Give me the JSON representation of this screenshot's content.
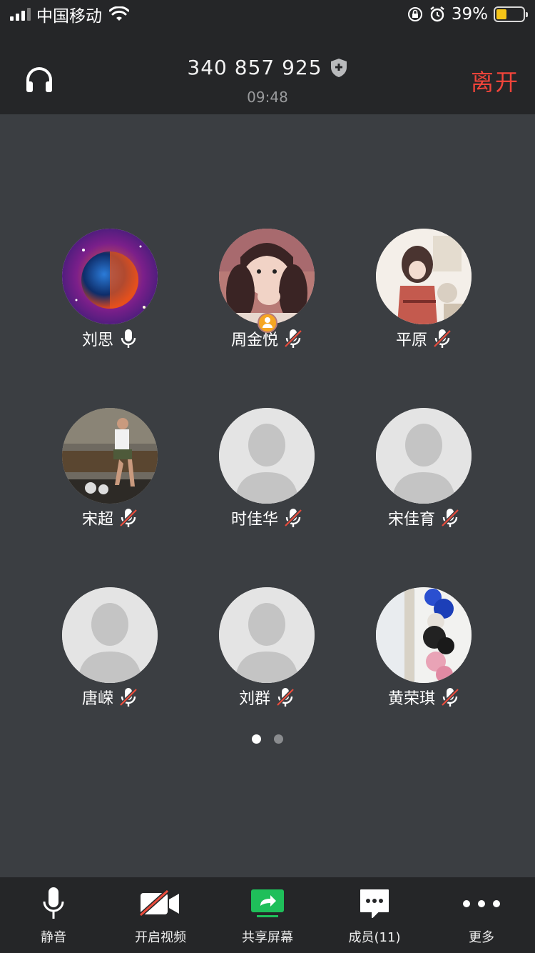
{
  "status_bar": {
    "carrier": "中国移动",
    "battery": "39%",
    "battery_level": 0.39,
    "battery_color": "#f5c518"
  },
  "header": {
    "meeting_id": "340 857 925",
    "timer": "09:48",
    "leave_label": "离开",
    "leave_color": "#f2443a"
  },
  "participants": [
    {
      "name": "刘思",
      "mic": "on",
      "avatar": "planet-photo"
    },
    {
      "name": "周金悦",
      "mic": "muted",
      "avatar": "girl-photo",
      "host": true
    },
    {
      "name": "平原",
      "mic": "muted",
      "avatar": "illustration"
    },
    {
      "name": "宋超",
      "mic": "muted",
      "avatar": "man-photo"
    },
    {
      "name": "时佳华",
      "mic": "muted",
      "avatar": "default"
    },
    {
      "name": "宋佳育",
      "mic": "muted",
      "avatar": "default"
    },
    {
      "name": "唐嵘",
      "mic": "muted",
      "avatar": "default"
    },
    {
      "name": "刘群",
      "mic": "muted",
      "avatar": "default"
    },
    {
      "name": "黄荣琪",
      "mic": "muted",
      "avatar": "toys-photo"
    }
  ],
  "pagination": {
    "pages": 2,
    "current": 1
  },
  "toolbar": {
    "mute_label": "静音",
    "video_label": "开启视频",
    "share_label": "共享屏幕",
    "members_label": "成员(11)",
    "more_label": "更多",
    "share_color": "#1fbf5a"
  }
}
